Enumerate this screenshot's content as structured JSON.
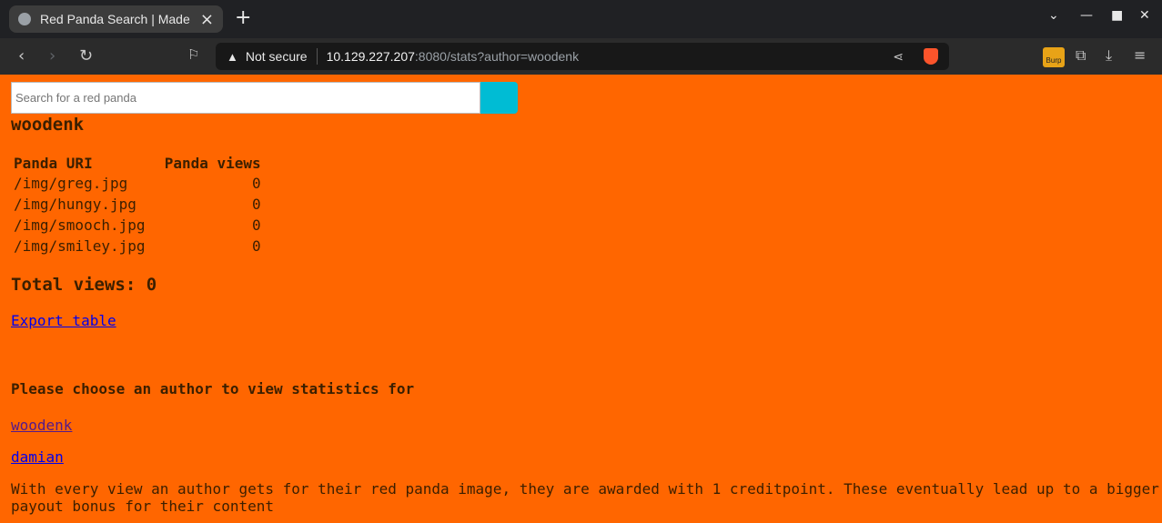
{
  "browser": {
    "tab_title": "Red Panda Search | Made with Spring Boot",
    "not_secure": "Not secure",
    "url_host": "10.129.227.207",
    "url_rest": ":8080/stats?author=woodenk",
    "burp_label": "Burp"
  },
  "page": {
    "search_placeholder": "Search for a red panda",
    "author": "woodenk",
    "table": {
      "headers": [
        "Panda URI",
        "Panda views"
      ],
      "rows": [
        {
          "uri": "/img/greg.jpg",
          "views": "0"
        },
        {
          "uri": "/img/hungy.jpg",
          "views": "0"
        },
        {
          "uri": "/img/smooch.jpg",
          "views": "0"
        },
        {
          "uri": "/img/smiley.jpg",
          "views": "0"
        }
      ]
    },
    "total_views": "Total views: 0",
    "export_link": "Export table",
    "choose_heading": "Please choose an author to view statistics for",
    "authors": [
      "woodenk",
      "damian"
    ],
    "description": "With every view an author gets for their red panda image, they are awarded with 1 creditpoint. These eventually lead up to a bigger payout bonus for their content"
  },
  "colors": {
    "page_bg": "#ff6600",
    "search_button": "#00bcd4"
  }
}
